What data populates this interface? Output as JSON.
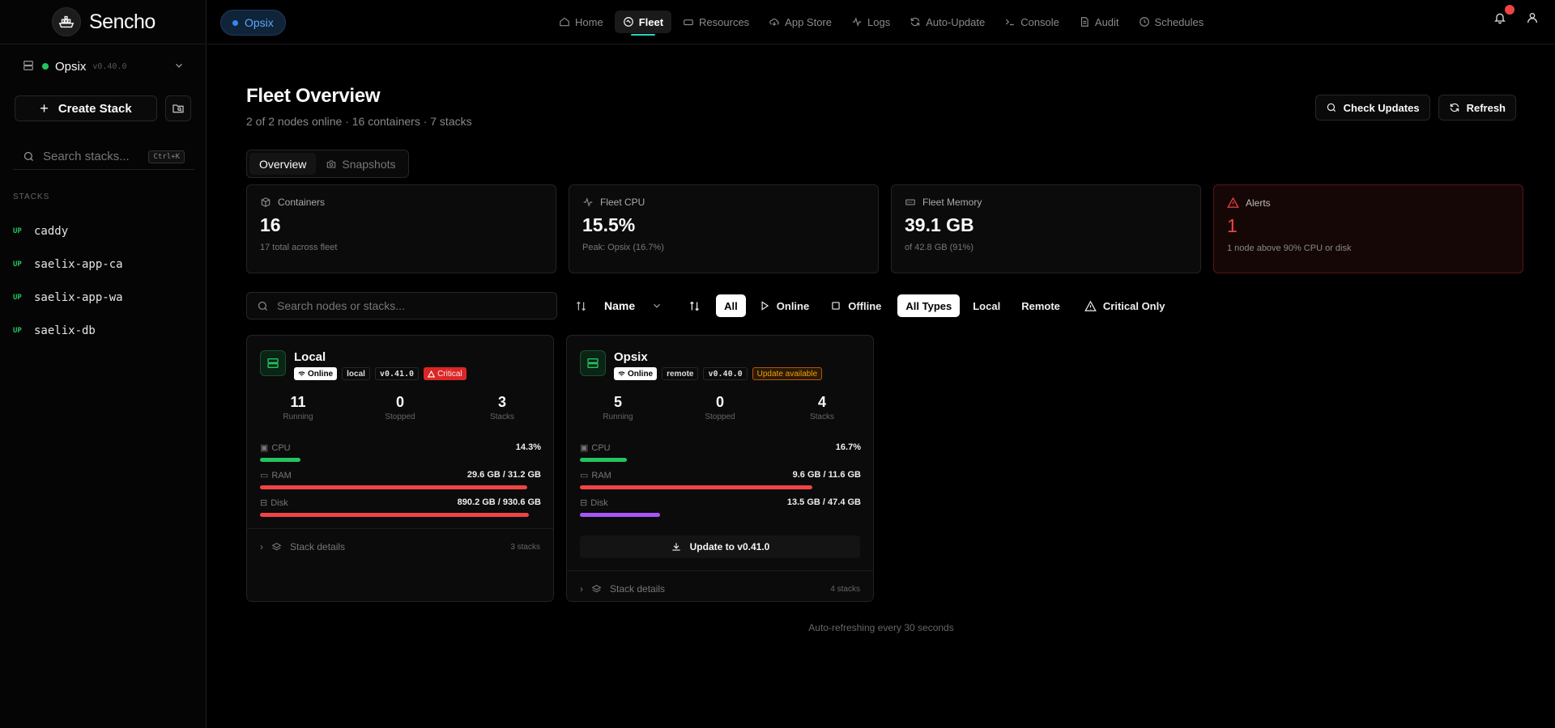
{
  "app": {
    "name": "Sencho"
  },
  "sidebar": {
    "node_name": "Opsix",
    "node_version": "v0.40.0",
    "create_label": "Create Stack",
    "search_placeholder": "Search stacks...",
    "search_shortcut": "Ctrl+K",
    "stacks_header": "STACKS",
    "stacks": [
      {
        "status": "UP",
        "name": "caddy"
      },
      {
        "status": "UP",
        "name": "saelix-app-ca"
      },
      {
        "status": "UP",
        "name": "saelix-app-wa"
      },
      {
        "status": "UP",
        "name": "saelix-db"
      }
    ]
  },
  "topbar": {
    "active_node": "Opsix",
    "nav": [
      {
        "label": "Home",
        "icon": "home-icon"
      },
      {
        "label": "Fleet",
        "icon": "fleet-icon",
        "active": true
      },
      {
        "label": "Resources",
        "icon": "drive-icon"
      },
      {
        "label": "App Store",
        "icon": "cloud-download-icon"
      },
      {
        "label": "Logs",
        "icon": "activity-icon"
      },
      {
        "label": "Auto-Update",
        "icon": "refresh-icon"
      },
      {
        "label": "Console",
        "icon": "terminal-icon"
      },
      {
        "label": "Audit",
        "icon": "audit-icon"
      },
      {
        "label": "Schedules",
        "icon": "clock-icon"
      }
    ]
  },
  "page": {
    "title": "Fleet Overview",
    "subtitle": "2 of 2 nodes online · 16 containers · 7 stacks",
    "check_updates": "Check Updates",
    "refresh": "Refresh",
    "tabs": {
      "overview": "Overview",
      "snapshots": "Snapshots"
    }
  },
  "stats": {
    "containers": {
      "label": "Containers",
      "value": "16",
      "sub": "17 total across fleet"
    },
    "cpu": {
      "label": "Fleet CPU",
      "value": "15.5%",
      "sub": "Peak: Opsix (16.7%)"
    },
    "memory": {
      "label": "Fleet Memory",
      "value": "39.1 GB",
      "sub": "of 42.8 GB (91%)"
    },
    "alerts": {
      "label": "Alerts",
      "value": "1",
      "sub": "1 node above 90% CPU or disk"
    }
  },
  "filters": {
    "search_placeholder": "Search nodes or stacks...",
    "sort_value": "Name",
    "all": "All",
    "online": "Online",
    "offline": "Offline",
    "all_types": "All Types",
    "local": "Local",
    "remote": "Remote",
    "critical_only": "Critical Only"
  },
  "nodes": [
    {
      "name": "Local",
      "status": "Online",
      "type": "local",
      "version": "v0.41.0",
      "flag": "Critical",
      "running": "11",
      "running_label": "Running",
      "stopped": "0",
      "stopped_label": "Stopped",
      "stacks": "3",
      "stacks_label": "Stacks",
      "cpu_label": "CPU",
      "cpu_value": "14.3%",
      "cpu_fraction": 0.143,
      "ram_label": "RAM",
      "ram_value": "29.6 GB / 31.2 GB",
      "ram_fraction": 0.95,
      "disk_label": "Disk",
      "disk_value": "890.2 GB / 930.6 GB",
      "disk_fraction": 0.957,
      "details_label": "Stack details",
      "details_count": "3 stacks"
    },
    {
      "name": "Opsix",
      "status": "Online",
      "type": "remote",
      "version": "v0.40.0",
      "flag": "Update available",
      "running": "5",
      "running_label": "Running",
      "stopped": "0",
      "stopped_label": "Stopped",
      "stacks": "4",
      "stacks_label": "Stacks",
      "cpu_label": "CPU",
      "cpu_value": "16.7%",
      "cpu_fraction": 0.167,
      "ram_label": "RAM",
      "ram_value": "9.6 GB / 11.6 GB",
      "ram_fraction": 0.828,
      "disk_label": "Disk",
      "disk_value": "13.5 GB / 47.4 GB",
      "disk_fraction": 0.285,
      "update_label": "Update to v0.41.0",
      "details_label": "Stack details",
      "details_count": "4 stacks"
    }
  ],
  "colors": {
    "green": "#22c55e",
    "red": "#ef4444",
    "purple": "#a855f7",
    "accent": "#2dd4bf"
  },
  "footer": "Auto-refreshing every 30 seconds"
}
